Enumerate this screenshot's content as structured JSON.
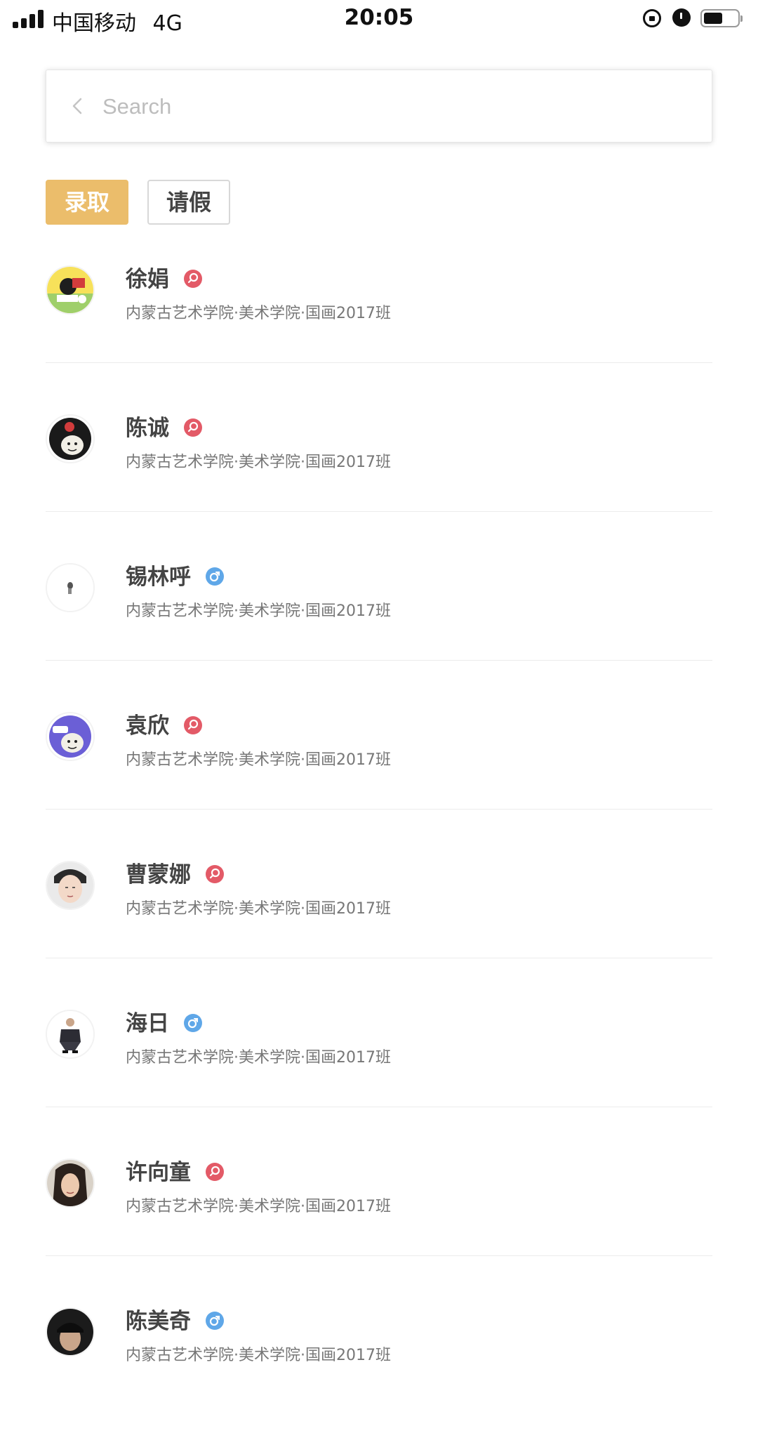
{
  "status_bar": {
    "carrier": "中国移动",
    "network": "4G",
    "time": "20:05"
  },
  "search": {
    "placeholder": "Search",
    "value": ""
  },
  "tabs": [
    {
      "label": "录取",
      "active": true
    },
    {
      "label": "请假",
      "active": false
    }
  ],
  "colors": {
    "accent": "#EBBD6B",
    "female_badge": "#E35A67",
    "male_badge": "#5FA7E8"
  },
  "students": [
    {
      "name": "徐娟",
      "gender": "female",
      "avatar": "cartoon-avatar-yellow",
      "info": "内蒙古艺术学院·美术学院·国画2017班"
    },
    {
      "name": "陈诚",
      "gender": "female",
      "avatar": "meme-avatar-black-helmet",
      "info": "内蒙古艺术学院·美术学院·国画2017班"
    },
    {
      "name": "锡林呼",
      "gender": "male",
      "avatar": "small-figure-avatar",
      "info": "内蒙古艺术学院·美术学院·国画2017班"
    },
    {
      "name": "袁欣",
      "gender": "female",
      "avatar": "meme-avatar-blue-helmet",
      "info": "内蒙古艺术学院·美术学院·国画2017班"
    },
    {
      "name": "曹蒙娜",
      "gender": "female",
      "avatar": "portrait-avatar-young-man",
      "info": "内蒙古艺术学院·美术学院·国画2017班"
    },
    {
      "name": "海日",
      "gender": "male",
      "avatar": "squatting-man-avatar",
      "info": "内蒙古艺术学院·美术学院·国画2017班"
    },
    {
      "name": "许向童",
      "gender": "female",
      "avatar": "portrait-avatar-woman",
      "info": "内蒙古艺术学院·美术学院·国画2017班"
    },
    {
      "name": "陈美奇",
      "gender": "male",
      "avatar": "portrait-avatar-dark",
      "info": "内蒙古艺术学院·美术学院·国画2017班"
    }
  ]
}
